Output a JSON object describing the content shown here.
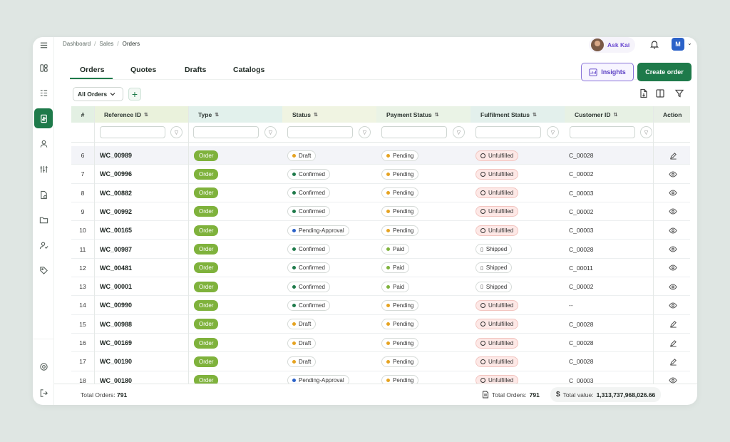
{
  "breadcrumb": [
    "Dashboard",
    "Sales",
    "Orders"
  ],
  "header": {
    "ask_kai": "Ask Kai",
    "user_initial": "M"
  },
  "tabs": [
    "Orders",
    "Quotes",
    "Drafts",
    "Catalogs"
  ],
  "buttons": {
    "insights": "Insights",
    "create_order": "Create order"
  },
  "filter": {
    "selected": "All Orders"
  },
  "columns": [
    "#",
    "Reference ID",
    "Type",
    "Status",
    "Payment Status",
    "Fulfilment Status",
    "Customer ID",
    "Action"
  ],
  "rows": [
    {
      "num": "6",
      "ref": "WC_00989",
      "type": "Order",
      "status": "Draft",
      "payment": "Pending",
      "fulfil": "Unfulfilled",
      "cust": "C_00028",
      "action": "edit"
    },
    {
      "num": "7",
      "ref": "WC_00996",
      "type": "Order",
      "status": "Confirmed",
      "payment": "Pending",
      "fulfil": "Unfulfilled",
      "cust": "C_00002",
      "action": "view"
    },
    {
      "num": "8",
      "ref": "WC_00882",
      "type": "Order",
      "status": "Confirmed",
      "payment": "Pending",
      "fulfil": "Unfulfilled",
      "cust": "C_00003",
      "action": "view"
    },
    {
      "num": "9",
      "ref": "WC_00992",
      "type": "Order",
      "status": "Confirmed",
      "payment": "Pending",
      "fulfil": "Unfulfilled",
      "cust": "C_00002",
      "action": "view"
    },
    {
      "num": "10",
      "ref": "WC_00165",
      "type": "Order",
      "status": "Pending-Approval",
      "payment": "Pending",
      "fulfil": "Unfulfilled",
      "cust": "C_00003",
      "action": "view"
    },
    {
      "num": "11",
      "ref": "WC_00987",
      "type": "Order",
      "status": "Confirmed",
      "payment": "Paid",
      "fulfil": "Shipped",
      "cust": "C_00028",
      "action": "view"
    },
    {
      "num": "12",
      "ref": "WC_00481",
      "type": "Order",
      "status": "Confirmed",
      "payment": "Paid",
      "fulfil": "Shipped",
      "cust": "C_00011",
      "action": "view"
    },
    {
      "num": "13",
      "ref": "WC_00001",
      "type": "Order",
      "status": "Confirmed",
      "payment": "Paid",
      "fulfil": "Shipped",
      "cust": "C_00002",
      "action": "view"
    },
    {
      "num": "14",
      "ref": "WC_00990",
      "type": "Order",
      "status": "Confirmed",
      "payment": "Pending",
      "fulfil": "Unfulfilled",
      "cust": "--",
      "action": "view"
    },
    {
      "num": "15",
      "ref": "WC_00988",
      "type": "Order",
      "status": "Draft",
      "payment": "Pending",
      "fulfil": "Unfulfilled",
      "cust": "C_00028",
      "action": "edit"
    },
    {
      "num": "16",
      "ref": "WC_00169",
      "type": "Order",
      "status": "Draft",
      "payment": "Pending",
      "fulfil": "Unfulfilled",
      "cust": "C_00028",
      "action": "edit"
    },
    {
      "num": "17",
      "ref": "WC_00190",
      "type": "Order",
      "status": "Draft",
      "payment": "Pending",
      "fulfil": "Unfulfilled",
      "cust": "C_00028",
      "action": "edit"
    },
    {
      "num": "18",
      "ref": "WC_00180",
      "type": "Order",
      "status": "Pending-Approval",
      "payment": "Pending",
      "fulfil": "Unfulfilled",
      "cust": "C_00003",
      "action": "view"
    }
  ],
  "footer": {
    "total_orders_label": "Total Orders:",
    "total_orders": "791",
    "total_value_label": "Total value:",
    "total_value": "1,313,737,968,026.66"
  },
  "colors": {
    "primary": "#1e7a4a",
    "type_pill": "#7fb23c",
    "draft_dot": "#e5a321",
    "confirmed_dot": "#1e7a4a",
    "pending_approval_dot": "#2b62c9",
    "pending_dot": "#e5a321",
    "paid_dot": "#7fb23c",
    "insights": "#5a3fc4"
  }
}
